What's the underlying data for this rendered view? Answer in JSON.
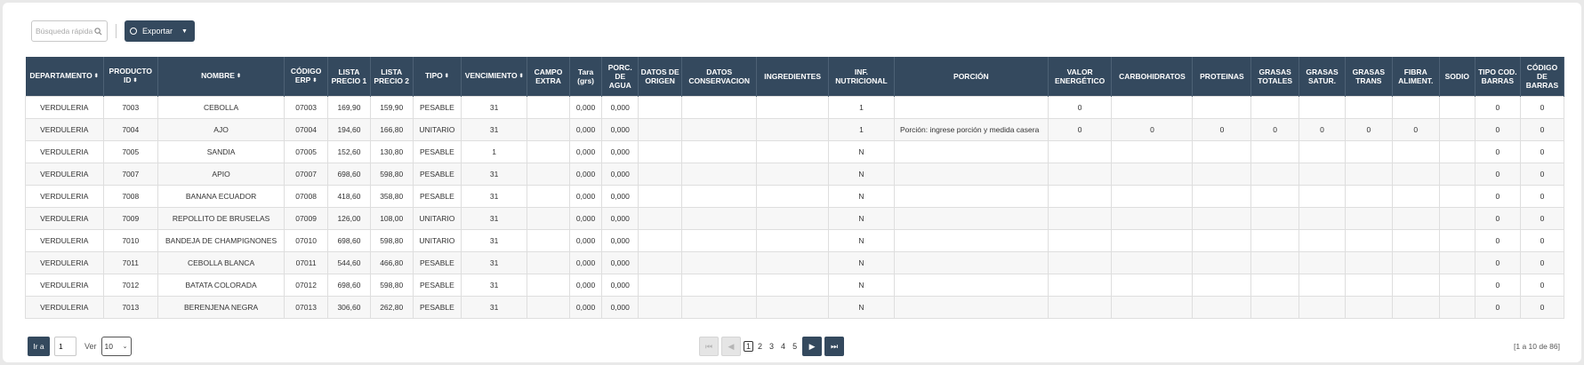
{
  "toolbar": {
    "search_placeholder": "Búsqueda rápida",
    "export_label": "Exportar"
  },
  "table": {
    "headers": [
      {
        "label": "DEPARTAMENTO",
        "sortable": true
      },
      {
        "label": "PRODUCTO ID",
        "sortable": true
      },
      {
        "label": "NOMBRE",
        "sortable": true
      },
      {
        "label": "CÓDIGO ERP",
        "sortable": true
      },
      {
        "label": "LISTA PRECIO 1",
        "sortable": false
      },
      {
        "label": "LISTA PRECIO 2",
        "sortable": false
      },
      {
        "label": "TIPO",
        "sortable": true
      },
      {
        "label": "VENCIMIENTO",
        "sortable": true
      },
      {
        "label": "CAMPO EXTRA",
        "sortable": false
      },
      {
        "label": "Tara (grs)",
        "sortable": false
      },
      {
        "label": "PORC. DE AGUA",
        "sortable": false
      },
      {
        "label": "DATOS DE ORIGEN",
        "sortable": false
      },
      {
        "label": "DATOS CONSERVACION",
        "sortable": false
      },
      {
        "label": "INGREDIENTES",
        "sortable": false
      },
      {
        "label": "INF. NUTRICIONAL",
        "sortable": false
      },
      {
        "label": "PORCIÓN",
        "sortable": false
      },
      {
        "label": "VALOR ENERGÉTICO",
        "sortable": false
      },
      {
        "label": "CARBOHIDRATOS",
        "sortable": false
      },
      {
        "label": "PROTEINAS",
        "sortable": false
      },
      {
        "label": "GRASAS TOTALES",
        "sortable": false
      },
      {
        "label": "GRASAS SATUR.",
        "sortable": false
      },
      {
        "label": "GRASAS TRANS",
        "sortable": false
      },
      {
        "label": "FIBRA ALIMENT.",
        "sortable": false
      },
      {
        "label": "SODIO",
        "sortable": false
      },
      {
        "label": "TIPO COD. BARRAS",
        "sortable": false
      },
      {
        "label": "CÓDIGO DE BARRAS",
        "sortable": false
      }
    ],
    "rows": [
      [
        "VERDULERIA",
        "7003",
        "CEBOLLA",
        "07003",
        "169,90",
        "159,90",
        "PESABLE",
        "31",
        "",
        "0,000",
        "0,000",
        "",
        "",
        "",
        "1",
        "",
        "0",
        "",
        "",
        "",
        "",
        "",
        "",
        "",
        "0",
        "0"
      ],
      [
        "VERDULERIA",
        "7004",
        "AJO",
        "07004",
        "194,60",
        "166,80",
        "UNITARIO",
        "31",
        "",
        "0,000",
        "0,000",
        "",
        "",
        "",
        "1",
        "Porción: ingrese porción y medida casera",
        "0",
        "0",
        "0",
        "0",
        "0",
        "0",
        "0",
        "",
        "0",
        "0"
      ],
      [
        "VERDULERIA",
        "7005",
        "SANDIA",
        "07005",
        "152,60",
        "130,80",
        "PESABLE",
        "1",
        "",
        "0,000",
        "0,000",
        "",
        "",
        "",
        "N",
        "",
        "",
        "",
        "",
        "",
        "",
        "",
        "",
        "",
        "0",
        "0"
      ],
      [
        "VERDULERIA",
        "7007",
        "APIO",
        "07007",
        "698,60",
        "598,80",
        "PESABLE",
        "31",
        "",
        "0,000",
        "0,000",
        "",
        "",
        "",
        "N",
        "",
        "",
        "",
        "",
        "",
        "",
        "",
        "",
        "",
        "0",
        "0"
      ],
      [
        "VERDULERIA",
        "7008",
        "BANANA ECUADOR",
        "07008",
        "418,60",
        "358,80",
        "PESABLE",
        "31",
        "",
        "0,000",
        "0,000",
        "",
        "",
        "",
        "N",
        "",
        "",
        "",
        "",
        "",
        "",
        "",
        "",
        "",
        "0",
        "0"
      ],
      [
        "VERDULERIA",
        "7009",
        "REPOLLITO DE BRUSELAS",
        "07009",
        "126,00",
        "108,00",
        "UNITARIO",
        "31",
        "",
        "0,000",
        "0,000",
        "",
        "",
        "",
        "N",
        "",
        "",
        "",
        "",
        "",
        "",
        "",
        "",
        "",
        "0",
        "0"
      ],
      [
        "VERDULERIA",
        "7010",
        "BANDEJA DE CHAMPIGNONES",
        "07010",
        "698,60",
        "598,80",
        "UNITARIO",
        "31",
        "",
        "0,000",
        "0,000",
        "",
        "",
        "",
        "N",
        "",
        "",
        "",
        "",
        "",
        "",
        "",
        "",
        "",
        "0",
        "0"
      ],
      [
        "VERDULERIA",
        "7011",
        "CEBOLLA BLANCA",
        "07011",
        "544,60",
        "466,80",
        "PESABLE",
        "31",
        "",
        "0,000",
        "0,000",
        "",
        "",
        "",
        "N",
        "",
        "",
        "",
        "",
        "",
        "",
        "",
        "",
        "",
        "0",
        "0"
      ],
      [
        "VERDULERIA",
        "7012",
        "BATATA COLORADA",
        "07012",
        "698,60",
        "598,80",
        "PESABLE",
        "31",
        "",
        "0,000",
        "0,000",
        "",
        "",
        "",
        "N",
        "",
        "",
        "",
        "",
        "",
        "",
        "",
        "",
        "",
        "0",
        "0"
      ],
      [
        "VERDULERIA",
        "7013",
        "BERENJENA NEGRA",
        "07013",
        "306,60",
        "262,80",
        "PESABLE",
        "31",
        "",
        "0,000",
        "0,000",
        "",
        "",
        "",
        "N",
        "",
        "",
        "",
        "",
        "",
        "",
        "",
        "",
        "",
        "0",
        "0"
      ]
    ]
  },
  "footer": {
    "goto_label": "Ir a",
    "page_value": "1",
    "ver_label": "Ver",
    "page_size": "10",
    "pages": [
      "1",
      "2",
      "3",
      "4",
      "5"
    ],
    "current_page": "1",
    "count_text": "[1 a 10 de 86]"
  },
  "colors": {
    "header_bg": "#34495e",
    "row_alt": "#f7f7f7"
  },
  "icons": {
    "search": "search-icon",
    "export": "export-icon",
    "caret": "chevron-down-icon",
    "first": "first-page-icon",
    "prev": "prev-page-icon",
    "next": "next-page-icon",
    "last": "last-page-icon"
  }
}
